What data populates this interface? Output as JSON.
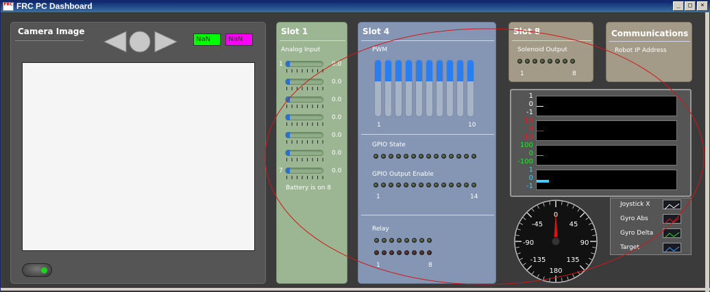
{
  "window": {
    "title": "FRC PC Dashboard",
    "icon_label": "FRC"
  },
  "window_controls": {
    "minimize": "_",
    "maximize": "□",
    "close": "×"
  },
  "camera": {
    "title": "Camera Image",
    "nan_green": "NaN",
    "nan_magenta": "NaN",
    "nan_green_color": "#00ff00",
    "nan_magenta_color": "#ff00ff"
  },
  "slot1": {
    "title": "Slot 1",
    "subtitle": "Analog Input",
    "first_index": "1",
    "last_index": "7",
    "values": [
      "0.0",
      "0.0",
      "0.0",
      "0.0",
      "0.0",
      "0.0",
      "0.0"
    ],
    "battery_note": "Battery is on 8",
    "bg_color": "#9cb694"
  },
  "slot4": {
    "title": "Slot 4",
    "pwm_label": "PWM",
    "pwm_first": "1",
    "pwm_last": "10",
    "pwm_levels": [
      0.37,
      0.37,
      0.37,
      0.37,
      0.37,
      0.37,
      0.37,
      0.37,
      0.37,
      0.37
    ],
    "gpio_state_label": "GPIO State",
    "gpio_output_label": "GPIO Output Enable",
    "gpio_first": "1",
    "gpio_last": "14",
    "relay_label": "Relay",
    "relay_first": "1",
    "relay_last": "8",
    "bg_color": "#8596b4"
  },
  "slot8": {
    "title": "Slot 8",
    "subtitle": "Solenoid Output",
    "first": "1",
    "last": "8",
    "bg_color": "#a49a88"
  },
  "comms": {
    "title": "Communications",
    "subtitle": "Robot IP Address",
    "bg_color": "#a49a88"
  },
  "graphs": [
    {
      "labels": [
        "1",
        "0",
        "-1"
      ],
      "color": "#ffffff"
    },
    {
      "labels": [
        "10",
        "0",
        "-10"
      ],
      "color": "#e02020"
    },
    {
      "labels": [
        "100",
        "0",
        "-100"
      ],
      "color": "#30e030"
    },
    {
      "labels": [
        "1",
        "0",
        "-1"
      ],
      "color": "#40d0ff"
    }
  ],
  "gyro": {
    "labels": {
      "top": "0",
      "top_left": "-45",
      "top_right": "45",
      "left": "-90",
      "right": "90",
      "bottom_left": "-135",
      "bottom_right": "135",
      "bottom": "180"
    },
    "needle_deg": 0
  },
  "legend": [
    {
      "label": "Joystick X",
      "color": "#ffffff"
    },
    {
      "label": "Gyro Abs",
      "color": "#e02020"
    },
    {
      "label": "Gyro Delta",
      "color": "#30e030"
    },
    {
      "label": "Target",
      "color": "#40a0ff"
    }
  ]
}
